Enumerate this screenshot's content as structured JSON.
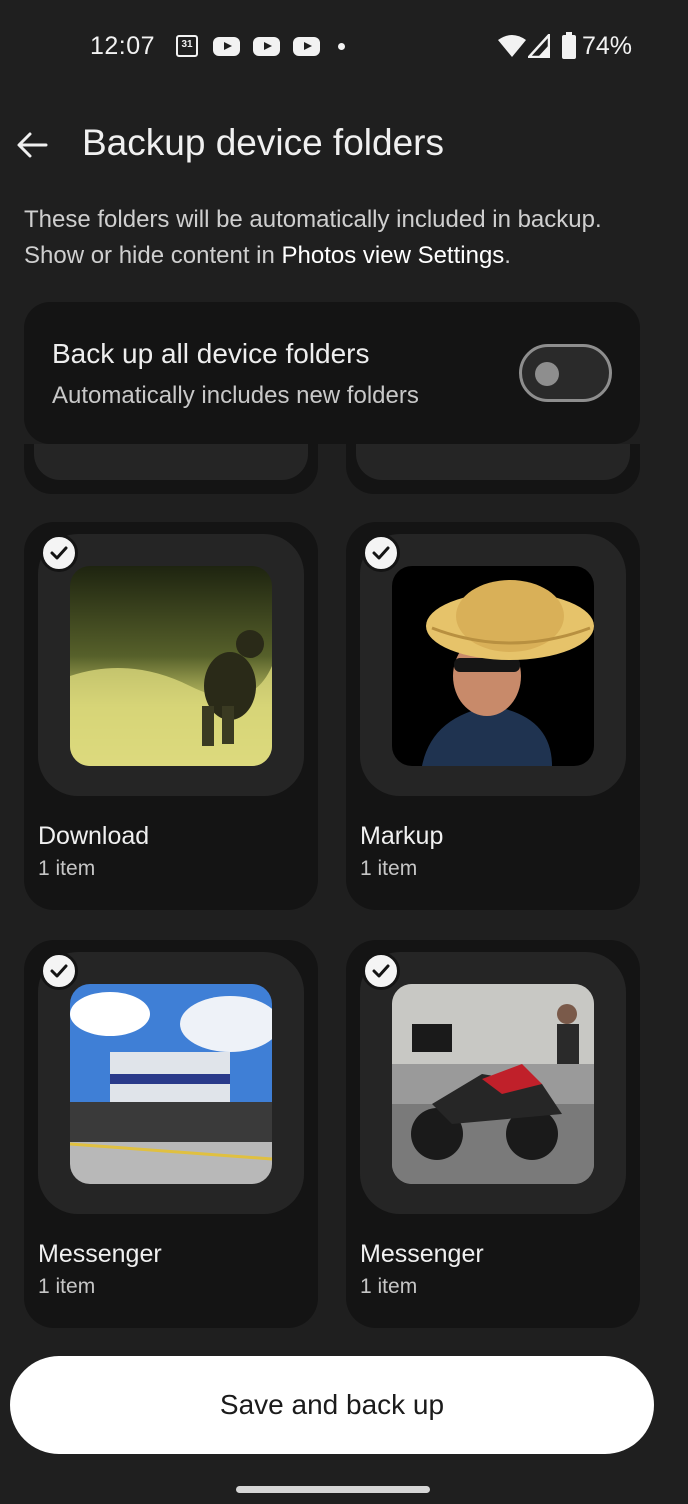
{
  "status_bar": {
    "time": "12:07",
    "calendar_day": "31",
    "battery": "74%",
    "icons": [
      "calendar-icon",
      "youtube-icon",
      "youtube-icon",
      "youtube-icon",
      "notification-dot",
      "wifi-icon",
      "signal-icon",
      "battery-icon"
    ]
  },
  "header": {
    "back_icon": "back-arrow-icon",
    "title": "Backup device folders"
  },
  "description": {
    "line1": "These folders will be automatically included in backup.",
    "line2_prefix": "Show or hide content in ",
    "line2_link": "Photos view Settings",
    "line2_suffix": "."
  },
  "backup_all": {
    "title": "Back up all device folders",
    "subtitle": "Automatically includes new folders",
    "enabled": false
  },
  "folders": [
    {
      "name": "Download",
      "count": "1 item",
      "selected": true
    },
    {
      "name": "Markup",
      "count": "1 item",
      "selected": true
    },
    {
      "name": "Messenger",
      "count": "1 item",
      "selected": true
    },
    {
      "name": "Messenger",
      "count": "1 item",
      "selected": true
    }
  ],
  "save_button": {
    "label": "Save and back up"
  },
  "colors": {
    "background": "#1f1f1f",
    "card": "#141414",
    "thumb_frame": "#252525",
    "button": "#ffffff"
  }
}
